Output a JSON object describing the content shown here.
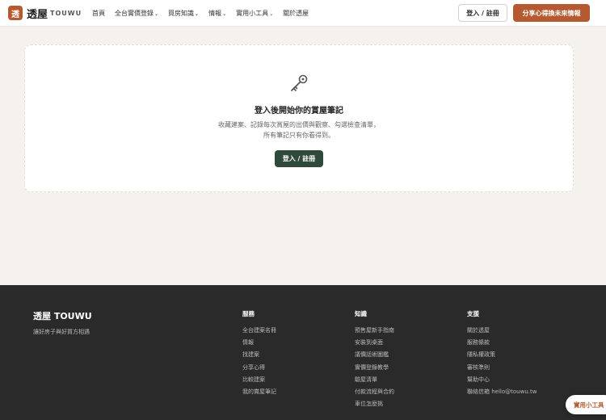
{
  "header": {
    "logo_char": "透",
    "brand": "透屋",
    "brand_en": "TOUWU",
    "nav": [
      {
        "label": "首頁",
        "has_dropdown": false
      },
      {
        "label": "全台實價登錄",
        "has_dropdown": true
      },
      {
        "label": "買房知識",
        "has_dropdown": true
      },
      {
        "label": "情報",
        "has_dropdown": true
      },
      {
        "label": "實用小工具",
        "has_dropdown": true
      },
      {
        "label": "關於透屋",
        "has_dropdown": false
      }
    ],
    "login_label": "登入 / 註冊",
    "share_label": "分享心得換未來情報"
  },
  "main": {
    "icon": "key-icon",
    "title": "登入後開始你的賞屋筆記",
    "desc_line1": "收藏建案、記錄每次賞屋的出價與觀察、勾選檢查清單，",
    "desc_line2": "所有筆記只有你看得到。",
    "login_label": "登入 / 註冊"
  },
  "footer": {
    "brand": "透屋 TOUWU",
    "tagline": "讓好房子與好買方相遇",
    "columns": [
      {
        "title": "服務",
        "items": [
          "全台建案名冊",
          "情報",
          "找建案",
          "分享心得",
          "比較建案",
          "我的賞屋筆記"
        ]
      },
      {
        "title": "知識",
        "items": [
          "預售屋新手指南",
          "安裝到桌面",
          "議價話術圖鑑",
          "實價登錄教學",
          "驗屋清單",
          "付款流程與合約",
          "車位怎麼挑"
        ]
      },
      {
        "title": "支援",
        "items": [
          "關於透屋",
          "服務條款",
          "隱私權政策",
          "審核準則",
          "幫助中心",
          "聯絡信箱 hello@touwu.tw"
        ]
      }
    ]
  },
  "floating": {
    "tools_label": "實用小工具"
  },
  "colors": {
    "accent": "#b55a30",
    "primary_dark": "#2f4a3a",
    "footer_bg": "#2a2a2a",
    "page_bg": "#f5f2ed"
  }
}
